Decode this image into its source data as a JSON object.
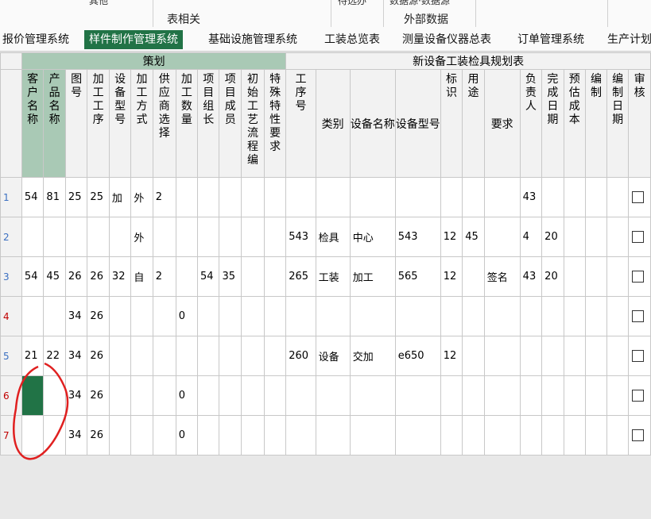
{
  "ribbon": {
    "group_table": "表相关",
    "group_external": "外部数据",
    "cut_left": "其他",
    "cut_mid": "待选办",
    "cut_right": "数据源·数据源"
  },
  "tabs": [
    {
      "label": "报价管理系统"
    },
    {
      "label": "样件制作管理系统"
    },
    {
      "label": "基础设施管理系统"
    },
    {
      "label": "工装总览表"
    },
    {
      "label": "测量设备仪器总表"
    },
    {
      "label": "订单管理系统"
    },
    {
      "label": "生产计划"
    }
  ],
  "bands": {
    "left": "策划",
    "right": "新设备工装检具规划表"
  },
  "columns": [
    "客户名称",
    "产品名称",
    "图号",
    "加工工序",
    "设备型号",
    "加工方式",
    "供应商选择",
    "加工数量",
    "项目组长",
    "项目成员",
    "初始工艺流程编",
    "特殊特性要求",
    "工序号",
    "类别",
    "设备名称",
    "设备型号",
    "标识",
    "用途",
    "要求",
    "负责人",
    "完成日期",
    "预估成本",
    "编制",
    "编制日期",
    "审核"
  ],
  "rows": [
    {
      "num": "1",
      "red": false,
      "cells": [
        "54",
        "81",
        "25",
        "25",
        "加",
        "外",
        "2",
        "",
        "",
        "",
        "",
        "",
        "",
        "",
        "",
        "",
        "",
        "",
        "",
        "43",
        "",
        "",
        "",
        "",
        ""
      ]
    },
    {
      "num": "2",
      "red": false,
      "cells": [
        "",
        "",
        "",
        "",
        "",
        "外",
        "",
        "",
        "",
        "",
        "",
        "",
        "543",
        "检具",
        "中心",
        "543",
        "12",
        "45",
        "",
        "4",
        "20",
        "",
        "",
        "",
        ""
      ]
    },
    {
      "num": "3",
      "red": false,
      "cells": [
        "54",
        "45",
        "26",
        "26",
        "32",
        "自",
        "2",
        "",
        "54",
        "35",
        "",
        "",
        "265",
        "工装",
        "加工",
        "565",
        "12",
        "",
        "签名",
        "43",
        "20",
        "",
        "",
        "",
        ""
      ]
    },
    {
      "num": "4",
      "red": true,
      "cells": [
        "",
        "",
        "34",
        "26",
        "",
        "",
        "",
        "0",
        "",
        "",
        "",
        "",
        "",
        "",
        "",
        "",
        "",
        "",
        "",
        "",
        "",
        "",
        "",
        "",
        ""
      ]
    },
    {
      "num": "5",
      "red": false,
      "cells": [
        "21",
        "22",
        "34",
        "26",
        "",
        "",
        "",
        "",
        "",
        "",
        "",
        "",
        "260",
        "设备",
        "交加",
        "e650",
        "12",
        "",
        "",
        "",
        "",
        "",
        "",
        "",
        ""
      ]
    },
    {
      "num": "6",
      "red": true,
      "cells": [
        "",
        "",
        "34",
        "26",
        "",
        "",
        "",
        "0",
        "",
        "",
        "",
        "",
        "",
        "",
        "",
        "",
        "",
        "",
        "",
        "",
        "",
        "",
        "",
        "",
        ""
      ]
    },
    {
      "num": "7",
      "red": true,
      "cells": [
        "",
        "",
        "34",
        "26",
        "",
        "",
        "",
        "0",
        "",
        "",
        "",
        "",
        "",
        "",
        "",
        "",
        "",
        "",
        "",
        "",
        "",
        "",
        "",
        "",
        ""
      ]
    }
  ],
  "colors": {
    "accent": "#217346",
    "selected_header": "#a9c9b5",
    "annotation": "#e02020"
  }
}
